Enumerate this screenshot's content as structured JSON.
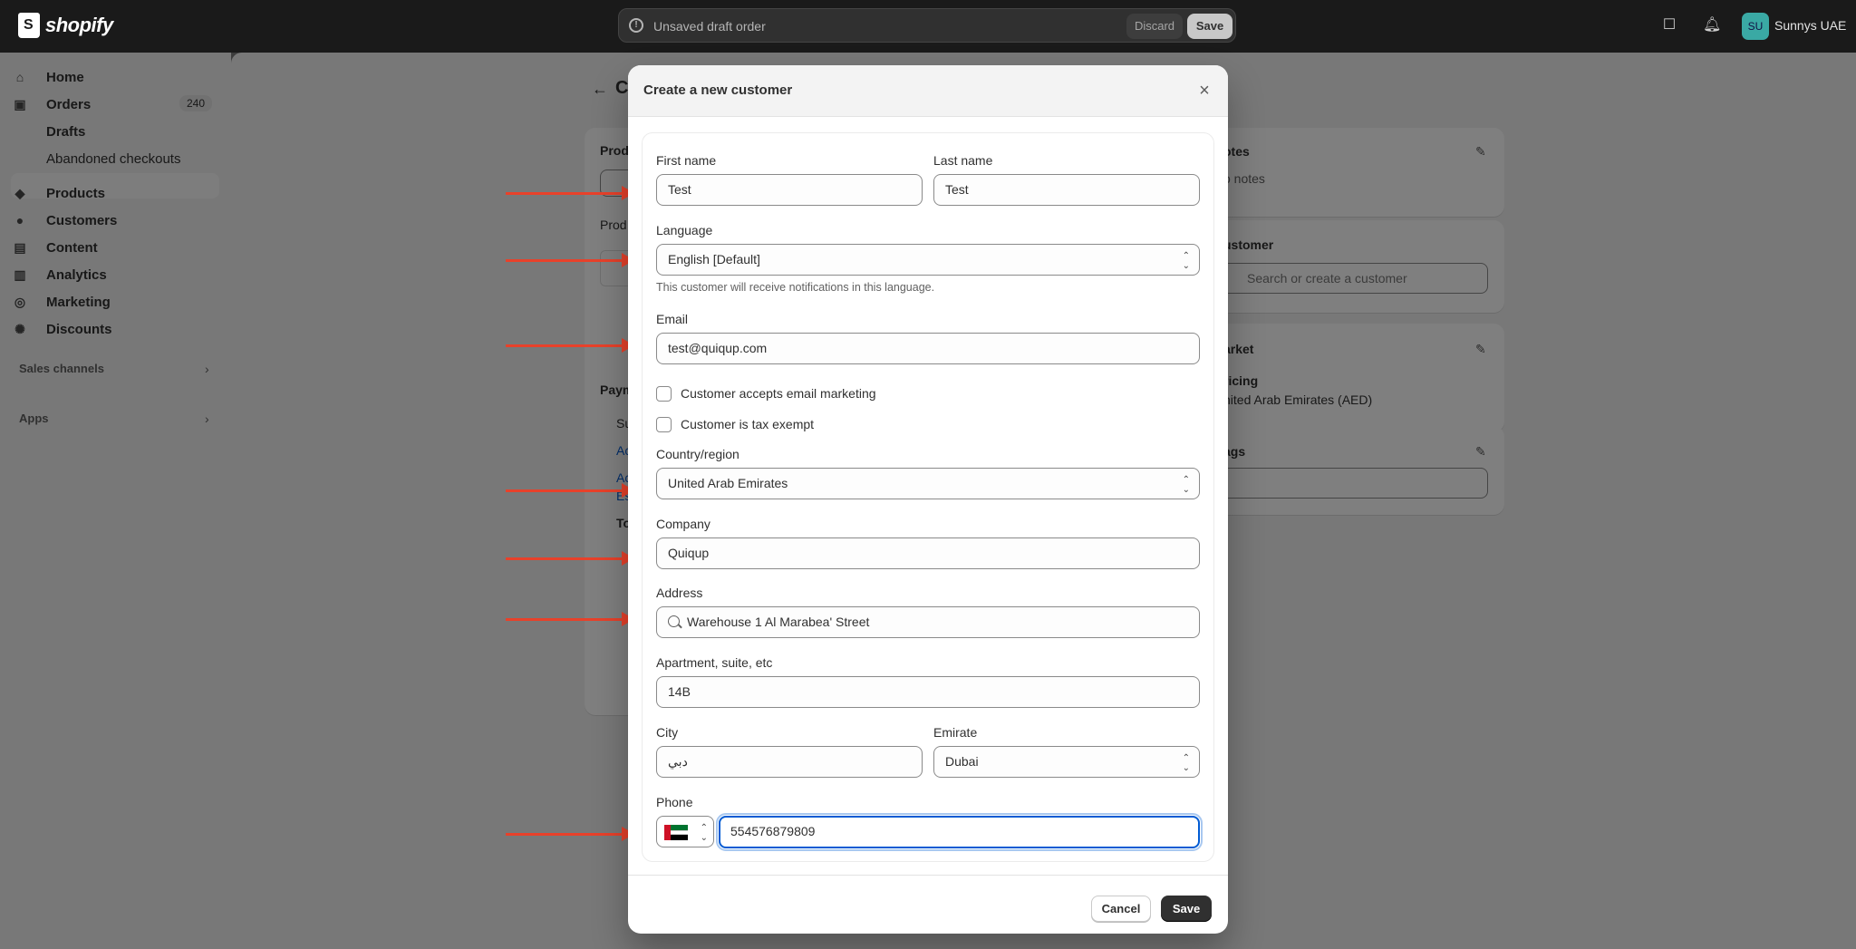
{
  "topbar": {
    "logo_text": "shopify",
    "draft_status": "Unsaved draft order",
    "discard_label": "Discard",
    "save_label": "Save",
    "avatar_initials": "SU",
    "store_name": "Sunnys UAE"
  },
  "sidebar": {
    "items": [
      {
        "label": "Home",
        "icon": "home-icon"
      },
      {
        "label": "Orders",
        "icon": "orders-icon",
        "badge": "240"
      },
      {
        "label": "Drafts"
      },
      {
        "label": "Abandoned checkouts"
      },
      {
        "label": "Products",
        "icon": "tag-icon"
      },
      {
        "label": "Customers",
        "icon": "person-icon"
      },
      {
        "label": "Content",
        "icon": "content-icon"
      },
      {
        "label": "Analytics",
        "icon": "chart-icon"
      },
      {
        "label": "Marketing",
        "icon": "target-icon"
      },
      {
        "label": "Discounts",
        "icon": "discount-icon"
      }
    ],
    "sales_channels": "Sales channels",
    "apps": "Apps"
  },
  "background": {
    "page_title_fragment": "C",
    "products_fragment": "Prod",
    "products_fragment_2": "Prod",
    "payment_fragment": "Paym",
    "payment_lines": [
      "Su",
      "Ac",
      "Ac",
      "Es",
      "To"
    ],
    "notes_title": "otes",
    "notes_text": "o notes",
    "customer_title": "ustomer",
    "customer_search_placeholder": "Search or create a customer",
    "market_title": "arket",
    "pricing_label": "ricing",
    "pricing_value": "nited Arab Emirates (AED)",
    "tags_title": "ags"
  },
  "modal": {
    "title": "Create a new customer",
    "first_name": {
      "label": "First name",
      "value": "Test"
    },
    "last_name": {
      "label": "Last name",
      "value": "Test"
    },
    "language": {
      "label": "Language",
      "value": "English [Default]",
      "help": "This customer will receive notifications in this language."
    },
    "email": {
      "label": "Email",
      "value": "test@quiqup.com"
    },
    "accepts_marketing": {
      "label": "Customer accepts email marketing",
      "checked": false
    },
    "tax_exempt": {
      "label": "Customer is tax exempt",
      "checked": false
    },
    "country": {
      "label": "Country/region",
      "value": "United Arab Emirates"
    },
    "company": {
      "label": "Company",
      "value": "Quiqup"
    },
    "address": {
      "label": "Address",
      "value": "Warehouse 1 Al Marabea' Street"
    },
    "apartment": {
      "label": "Apartment, suite, etc",
      "value": "14B"
    },
    "city": {
      "label": "City",
      "value": "دبي"
    },
    "emirate": {
      "label": "Emirate",
      "value": "Dubai"
    },
    "phone": {
      "label": "Phone",
      "value": "554576879809",
      "flag": "uae-flag-icon"
    },
    "cancel_label": "Cancel",
    "save_label": "Save"
  },
  "colors": {
    "annotation_arrow": "#e8412a",
    "primary_button": "#303030",
    "focus_ring": "#005bd3"
  }
}
